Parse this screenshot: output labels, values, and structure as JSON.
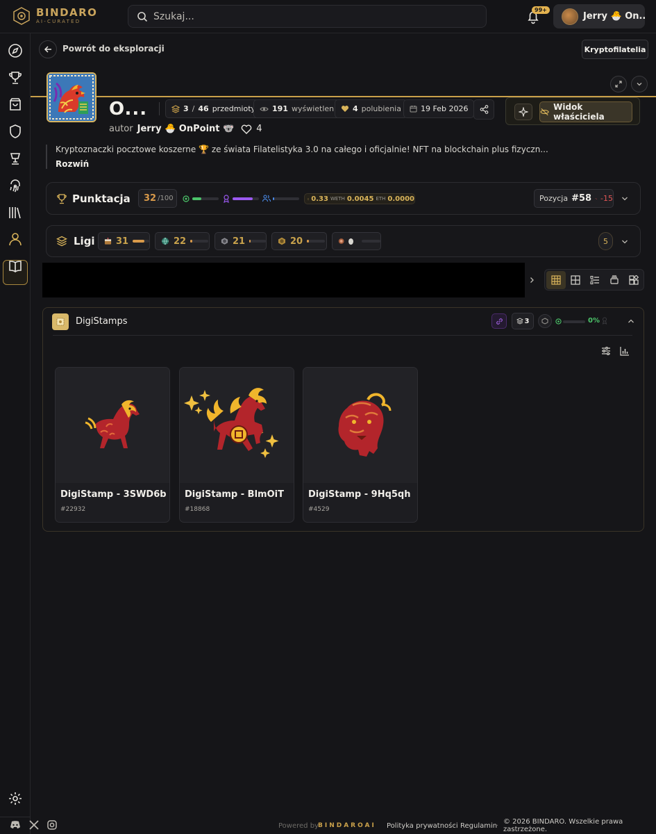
{
  "brand": {
    "name": "BINDARO",
    "tagline": "AI-CURATED"
  },
  "search": {
    "placeholder": "Szukaj..."
  },
  "notifications": {
    "badge": "99+"
  },
  "user": {
    "name": "Jerry 🐣 On..."
  },
  "nav": {
    "back_label": "Powrót do eksploracji",
    "category": "Kryptofilatelia"
  },
  "collection": {
    "title": "O...",
    "items_owned": "3",
    "items_sep": "/",
    "items_total": "46",
    "items_label": "przedmioty",
    "views": "191",
    "views_label": "wyświetlenia",
    "likes": "4",
    "likes_label": "polubienia",
    "date": "19 Feb 2026",
    "author_label": "autor",
    "author_name": "Jerry 🐣 OnPoint 🐨",
    "author_likes": "4",
    "owner_view_label": "Widok właściciela",
    "description": "Kryptoznaczki pocztowe koszerne 🏆 ze świata Filatelistyka 3.0 na całego i oficjalnie! NFT na blockchain plus fizyczn...",
    "expand_label": "Rozwiń"
  },
  "score": {
    "title": "Punktacja",
    "value": "32",
    "max": "/100",
    "bar1": 0.35,
    "bar2": 0.75,
    "bar3": 0.05,
    "weth_value": "0.33",
    "weth_label": "WETH",
    "eth_value": "0.0045",
    "eth_label": "ETH",
    "third_value": "0.0000",
    "position_label": "Pozycja",
    "position_value": "#58",
    "position_change": "-15"
  },
  "leagues": {
    "title": "Ligi",
    "items": [
      {
        "value": "31",
        "progress": 0.7
      },
      {
        "value": "22",
        "progress": 0.1
      },
      {
        "value": "21",
        "progress": 0.1
      },
      {
        "value": "20",
        "progress": 0.1
      },
      {
        "value": "",
        "progress": 0.0
      }
    ],
    "count": "5"
  },
  "section": {
    "title": "DigiStamps",
    "count": "3",
    "percent": "0%",
    "percent_fill": 0.0
  },
  "items": [
    {
      "name": "DigiStamp - 3SWD6b",
      "id": "#22932"
    },
    {
      "name": "DigiStamp - BlmOiT",
      "id": "#18868"
    },
    {
      "name": "DigiStamp - 9Hq5qh",
      "id": "#4529"
    }
  ],
  "footer": {
    "powered_by": "Powered by",
    "powered_brand": "BINDAROAI",
    "privacy": "Polityka prywatności",
    "terms": "Regulamin",
    "copyright": "© 2026 BINDARO. Wszelkie prawa zastrzeżone.",
    "separator": "·"
  },
  "colors": {
    "accent": "#c9a04a",
    "background": "#151518",
    "panel": "#17171a",
    "negative": "#e05555"
  }
}
